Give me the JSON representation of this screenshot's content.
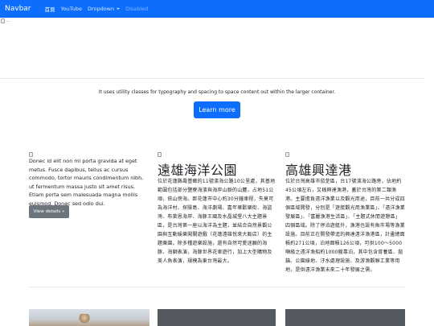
{
  "navbar": {
    "brand": "Navbar",
    "links": [
      {
        "label": "首頁",
        "state": "active"
      },
      {
        "label": "YouTube",
        "state": "normal"
      },
      {
        "label": "Dropdown",
        "state": "dropdown"
      },
      {
        "label": "Disabled",
        "state": "disabled"
      }
    ],
    "color": "#0d6efd"
  },
  "hero": {
    "broken_image": "broken-image-icon"
  },
  "lead": {
    "text": "It uses utility classes for typography and spacing to space content out within the larger container.",
    "button": "Learn more"
  },
  "cards": [
    {
      "text": "Donec id elit non mi porta gravida at eget metus. Fusce dapibus, tellus ac cursus commodo, tortor mauris condimentum nibh, ut fermentum massa justo sit amet risus. Etiam porta sem malesuada magna mollis euismod. Donec sed odio dui.",
      "button": "View details »"
    },
    {
      "title": "遠雄海洋公園",
      "text": "位於花蓮縣壽豐鄉的11號濱海公路10公里處，其基地範圍包括部分鹽寮海濱與海岸山脈的山麓，占地51公頃，依山傍海。距花蓮市中心約30分鐘車程，失莫可為海洋村、探險島、海洋劇場、嘉年華歡樂街、海盜灣、布萊恩海岸、海豚王國及水晶城堡八大主題景區，是台灣第一座以海洋為主題，並結合自然景觀公園與互動娛樂闖關遊戲（花蓮遠雄悅來大飯店）的主題樂園。除多種遊樂設施，還有自然可愛迷願的海豚、海獅表演，海豚世界花車遊行，加上大型購物及美人魚表演，規模為東台灣最大。"
    },
    {
      "title": "高雄興達港",
      "text": "位於台灣高雄市茄萣區，台17號濱海公路旁，佔地約45公頃左右，又稱興達漁港，蓄於台灣的第二類漁港。主要擔負遠洋漁業以及觀光用途，目前一共分成四個區域開發，分別是「遊艇觀光用漁業區」、「遠洋漁業發展區」、「富麗漁港生活區」、「主題式休閒遊憩區」四個區域。除了停泊遊艇外，漁港也設有魚市場等漁業設施。目前正在開發帶逕的興達遠洋漁港區，計畫總面積約271公頃，泊地面積126公頃，可供100～5000噸級之遠洋漁船約1000艘靠泊，其中包含育養區、拋錨、公園綠地、汙水處理設施、及游漁觀聯工業等用地，是供遠洋漁業未來二十年發展之需。"
    }
  ],
  "footer_tiles": [
    "photo",
    "dark",
    "dark"
  ]
}
